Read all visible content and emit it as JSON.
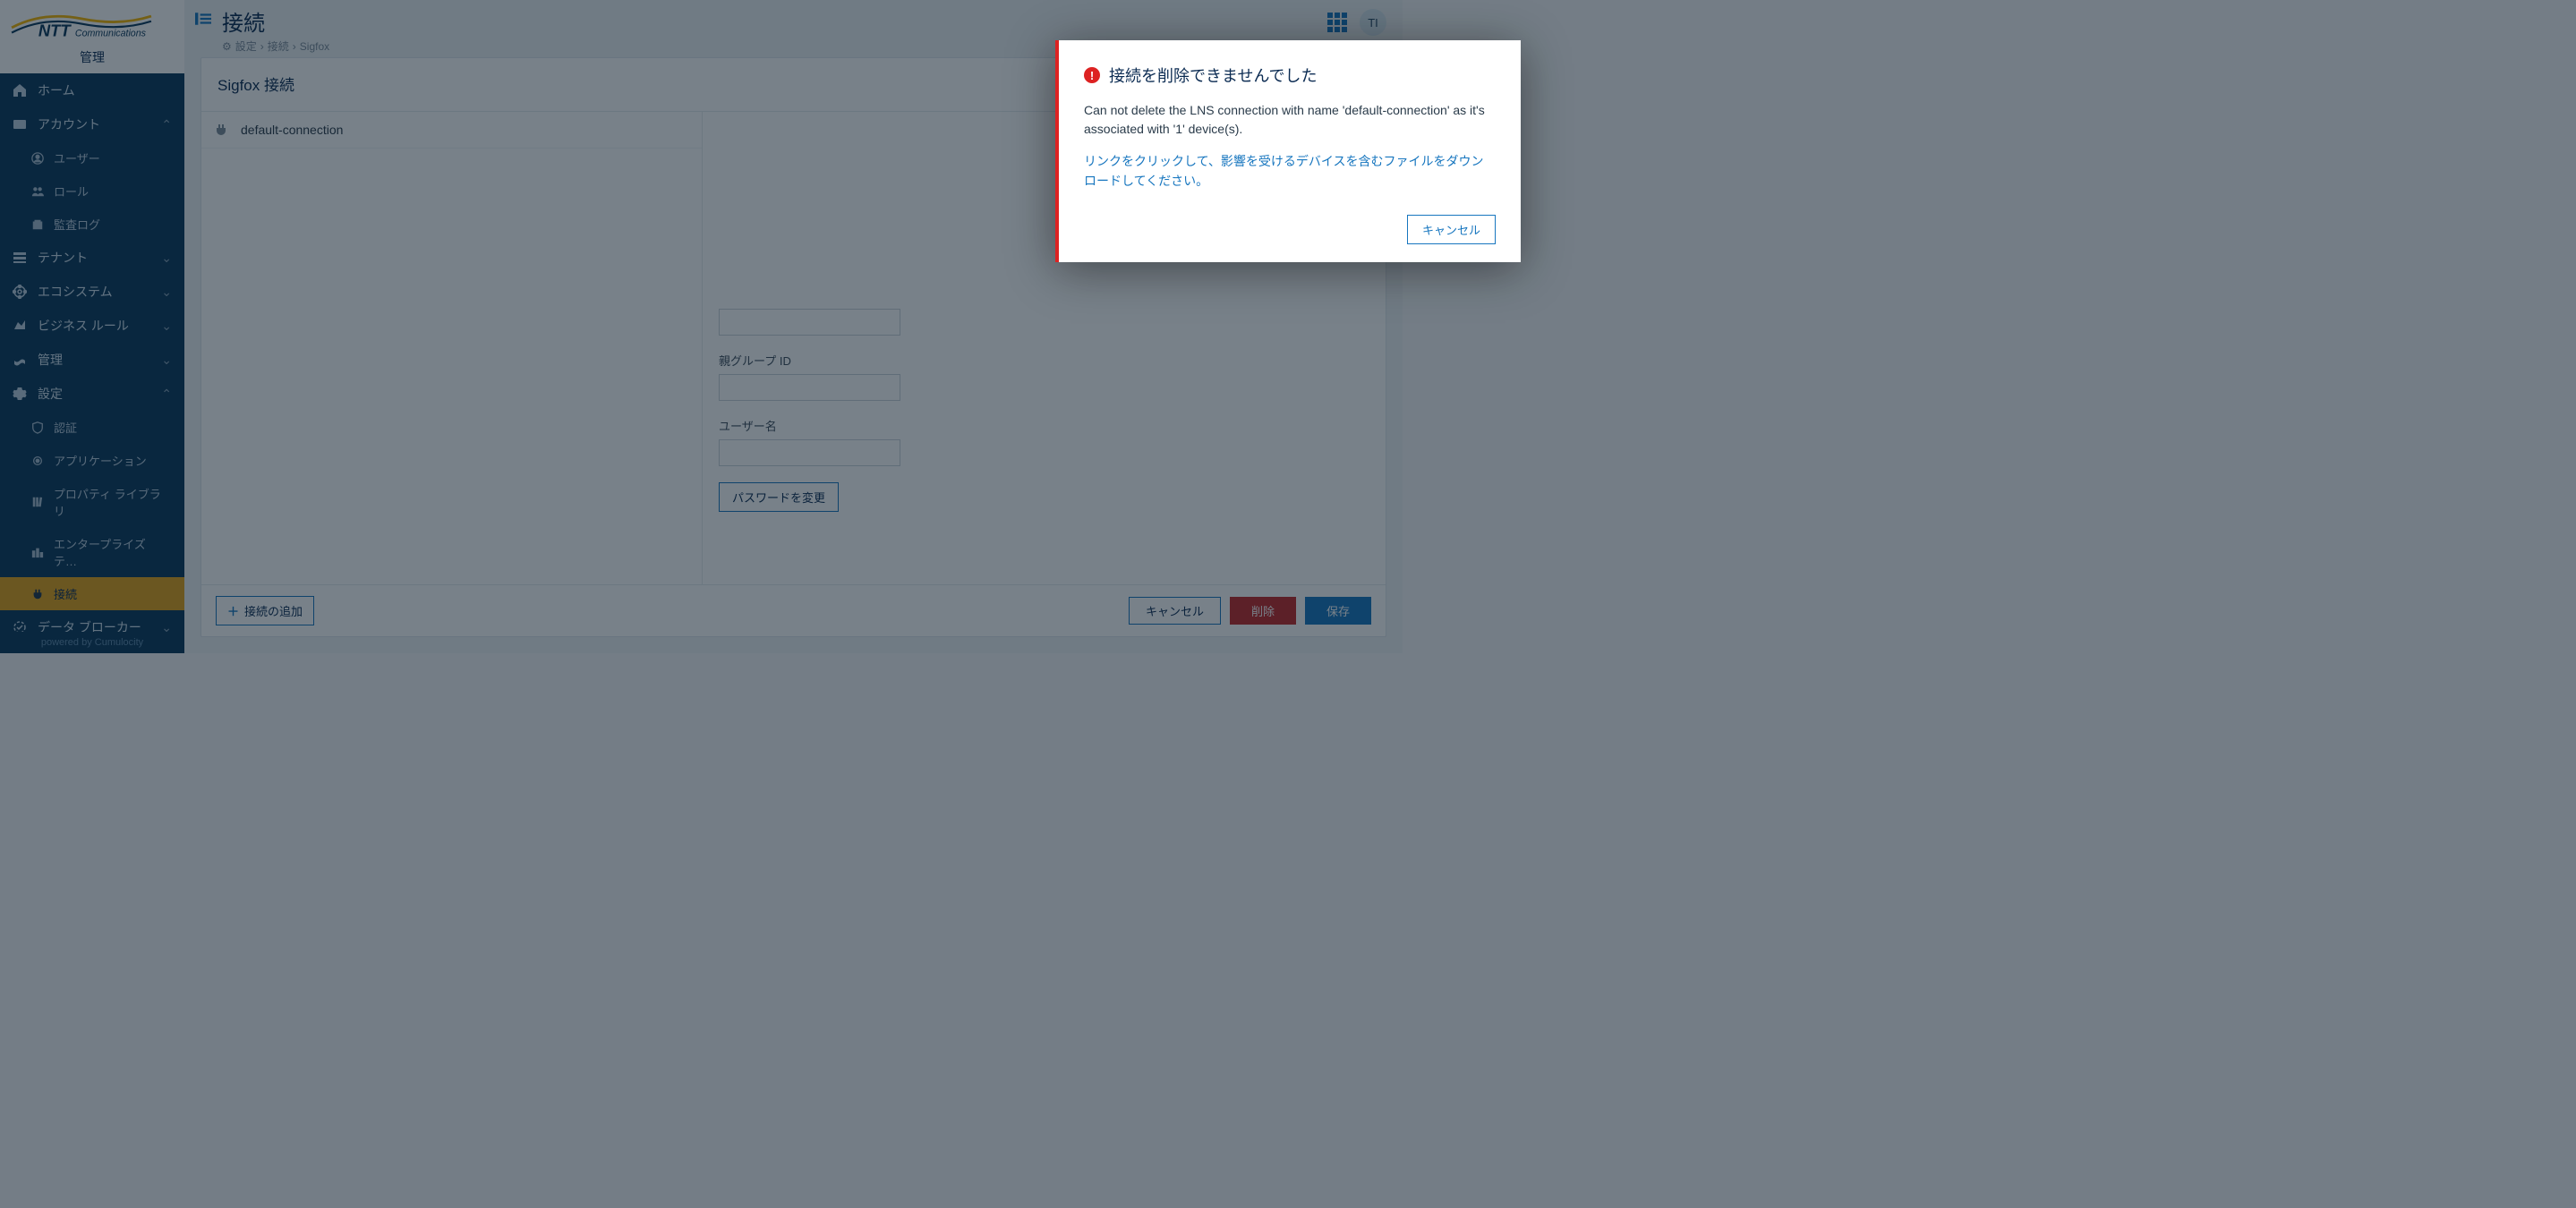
{
  "brand": {
    "name": "NTT Communications",
    "admin_label": "管理",
    "powered": "powered by Cumulocity"
  },
  "header": {
    "title": "接続",
    "breadcrumb": [
      "設定",
      "接続",
      "Sigfox"
    ],
    "avatar": "TI"
  },
  "nav": {
    "home": "ホーム",
    "account": "アカウント",
    "account_sub": {
      "user": "ユーザー",
      "role": "ロール",
      "audit": "監査ログ"
    },
    "tenant": "テナント",
    "ecosystem": "エコシステム",
    "bizrule": "ビジネス ルール",
    "manage": "管理",
    "settings": "設定",
    "settings_sub": {
      "auth": "認証",
      "app": "アプリケーション",
      "props": "プロパティ ライブラリ",
      "ent": "エンタープライズ テ…",
      "conn": "接続"
    },
    "broker": "データ ブローカー"
  },
  "panel": {
    "title": "Sigfox 接続",
    "list": [
      {
        "name": "default-connection"
      }
    ],
    "fields": {
      "parent_group": "親グループ ID",
      "username": "ユーザー名",
      "change_pw": "パスワードを変更"
    },
    "add_conn": "接続の追加",
    "cancel": "キャンセル",
    "delete": "削除",
    "save": "保存"
  },
  "modal": {
    "title": "接続を削除できませんでした",
    "body": "Can not delete the LNS connection with name 'default-connection' as it's associated with '1' device(s).",
    "link": "リンクをクリックして、影響を受けるデバイスを含むファイルをダウンロードしてください。",
    "cancel": "キャンセル"
  }
}
